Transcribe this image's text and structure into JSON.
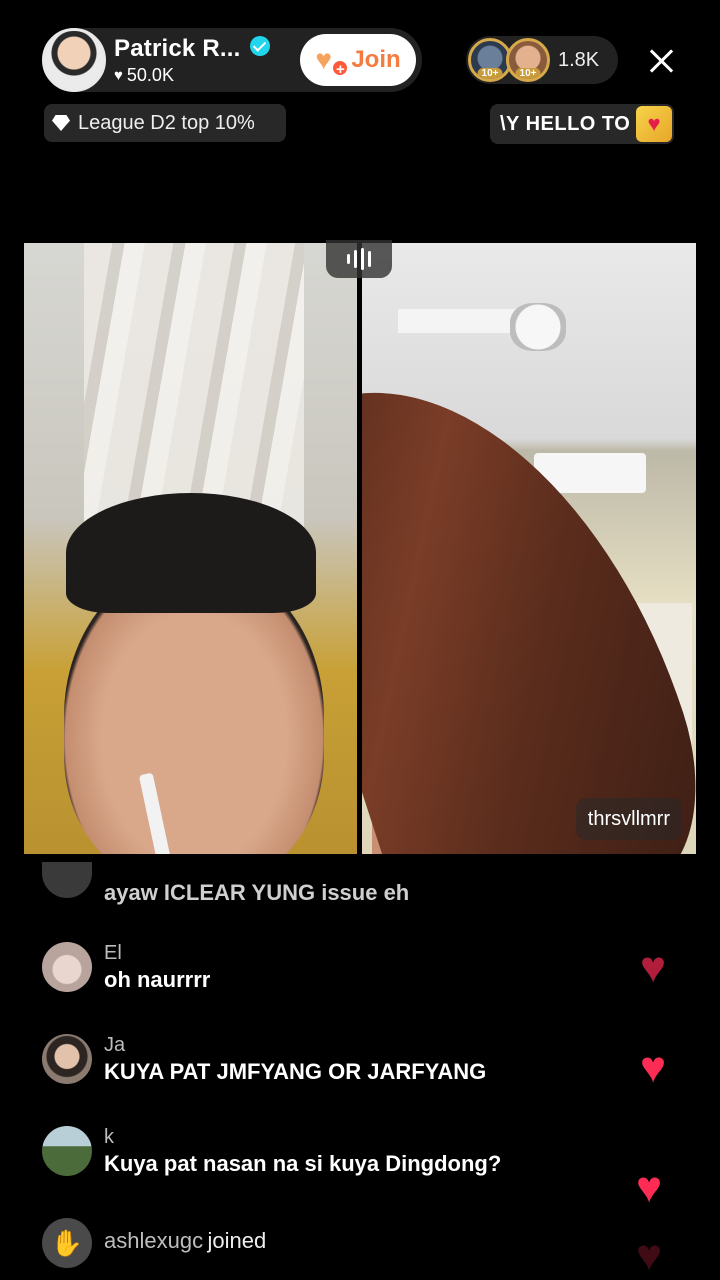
{
  "header": {
    "host_name": "Patrick R...",
    "host_likes": "50.0K",
    "join_label": "Join",
    "viewer_badges": [
      "10+",
      "10+"
    ],
    "viewer_count": "1.8K",
    "league_text": "League D2 top 10%",
    "marquee_text": "\\Y HELLO TO ! ",
    "icons": {
      "verified": "verified-check-icon",
      "heart": "heart-icon",
      "diamond": "diamond-icon",
      "gift": "gift-box-icon",
      "close": "close-icon",
      "join": "heart-plus-icon"
    }
  },
  "video": {
    "guest_name": "thrsvllmrr"
  },
  "chat": [
    {
      "user": "",
      "message": "ayaw ICLEAR YUNG issue eh",
      "avatar_color": "#3a3a3a"
    },
    {
      "user": "El",
      "message": "oh naurrrr",
      "avatar_color": "#c8b7ae"
    },
    {
      "user": "Ja",
      "message": "KUYA PAT JMFYANG OR JARFYANG",
      "avatar_color": "#7a6a60"
    },
    {
      "user": "k",
      "message": "Kuya pat nasan na si kuya Dingdong?",
      "avatar_color": "#4c6b3a"
    },
    {
      "user": "ashlexugc",
      "message": "joined",
      "avatar_color": "#5a5a5a"
    }
  ],
  "colors": {
    "accent_heart": "#fd2c55",
    "join_text": "#f57c3e",
    "verified": "#20d5ec"
  }
}
